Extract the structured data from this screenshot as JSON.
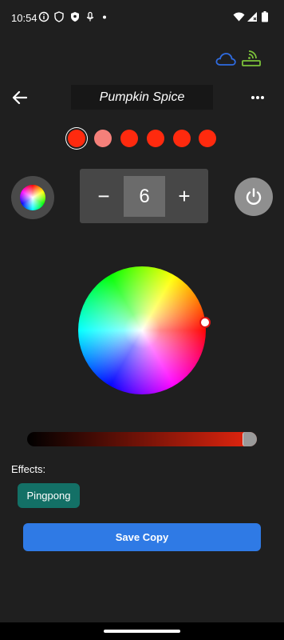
{
  "status_bar": {
    "time": "10:54",
    "icons": [
      "info-icon",
      "shield-outline-icon",
      "shield-filled-icon",
      "mic-icon",
      "dot-icon",
      "wifi-icon",
      "signal-icon",
      "battery-icon"
    ]
  },
  "top_icons": {
    "cloud": "cloud-icon",
    "router": "router-icon",
    "cloud_color": "#2f6be0",
    "router_color": "#7cc23a"
  },
  "header": {
    "back_icon": "arrow-left-icon",
    "title": "Pumpkin Spice",
    "more_icon": "more-horizontal-icon"
  },
  "swatches": [
    {
      "color": "#ff2a0e",
      "selected": true
    },
    {
      "color": "#f5807a",
      "selected": false
    },
    {
      "color": "#ff2a0e",
      "selected": false
    },
    {
      "color": "#ff2a0e",
      "selected": false
    },
    {
      "color": "#ff2a0e",
      "selected": false
    },
    {
      "color": "#ff2a0e",
      "selected": false
    }
  ],
  "stepper": {
    "minus": "−",
    "value": "6",
    "plus": "+"
  },
  "power_icon": "power-icon",
  "brightness": {
    "level": 0.94,
    "color": "#e8260f"
  },
  "effects": {
    "label": "Effects:",
    "items": [
      "Pingpong"
    ]
  },
  "actions": {
    "save_copy": "Save Copy"
  },
  "colors": {
    "background": "#1f1f1f",
    "accent": "#2f7ae5",
    "chip": "#137066"
  }
}
